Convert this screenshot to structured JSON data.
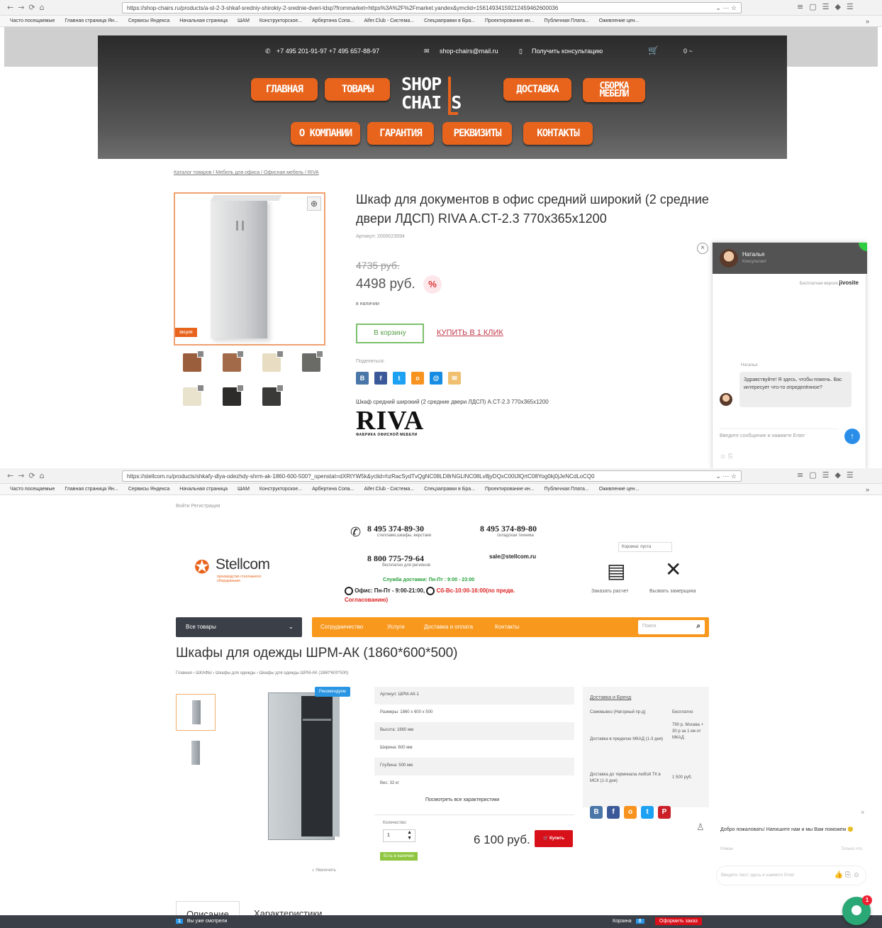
{
  "browser1": {
    "url": "https://shop-chairs.ru/products/a-st-2-3-shkaf-sredniy-shirokiy-2-srednie-dveri-ldsp?frommarket=https%3A%2F%2Fmarket.yandex&ymclid=15614934159212459462600036",
    "bookmarks": [
      "Часто посещаемые",
      "Главная страница Ян...",
      "Сервисы Яндекса",
      "Начальная страница",
      "ШАМ",
      "Конструкторское...",
      "Арбертина Сопа...",
      "Aifer.Club - Система...",
      "Спецзаправки в Бра...",
      "Проектирование ин...",
      "Публичная Плата...",
      "Оживление цен..."
    ]
  },
  "browser2": {
    "url": "https://stellcom.ru/products/shkafy-dlya-odezhdy-shrm-ak-1860-600-500?_openstat=dXRtYW5k&yclid=hzRacSydTvQgNC08LD8rNGLlNC08Lv8jyDQxC00lJlQrtC08Yog0kj0jJeNCdLoCQ0",
    "bookmarks": [
      "Часто посещаемые",
      "Главная страница Ян...",
      "Сервисы Яндекса",
      "Начальная страница",
      "ШАМ",
      "Конструкторское...",
      "Арбертина Сопа...",
      "Aifer.Club - Система...",
      "Спецзаправки в Бра...",
      "Проектирование ин...",
      "Публичная Плата...",
      "Оживление цен..."
    ]
  },
  "shop_chairs": {
    "phones": "+7 495 201-91-97   +7 495 657-88-97",
    "email": "shop-chairs@mail.ru",
    "consult": "Получить консультацию",
    "cart_count": "0 ~",
    "logo_line1": "SHOP",
    "logo_line2": "CHAI S",
    "nav_top": [
      "ГЛАВНАЯ",
      "ТОВАРЫ",
      "ДОСТАВКА",
      "СБОРКА МЕБЕЛИ"
    ],
    "nav_bottom": [
      "О КОМПАНИИ",
      "ГАРАНТИЯ",
      "РЕКВИЗИТЫ",
      "КОНТАКТЫ"
    ],
    "breadcrumb": "Каталог товаров / Мебель для офиса / Офисная мебель / RIVA",
    "promo_badge": "акция",
    "title": "Шкаф для документов в офис средний широкий (2 средние двери ЛДСП) RIVA A.CT-2.3 770x365x1200",
    "sku": "Артикул: 2000023594",
    "old_price": "4735 руб.",
    "price": "4498 руб.",
    "discount_icon": "%",
    "stock": "в наличии",
    "cart_button": "В корзину",
    "one_click": "КУПИТЬ В 1 КЛИК",
    "share_label": "Поделиться:",
    "short_desc": "Шкаф средний широкий (2 средние двери ЛДСП) A.CT-2.3 770x365x1200",
    "brand_word": "RIVA",
    "brand_sub": "ФАБРИКА ОФИСНОЙ МЕБЕЛИ",
    "swatch_colors": [
      "#9a5e3c",
      "#a26a48",
      "#e8dcc2",
      "#6a6a66",
      "#e9e2cc",
      "#2e2c2a",
      "#3a3a38"
    ],
    "social": [
      {
        "label": "В",
        "color": "#4a76a8"
      },
      {
        "label": "f",
        "color": "#3b5998"
      },
      {
        "label": "t",
        "color": "#1da1f2"
      },
      {
        "label": "о",
        "color": "#f7931e"
      },
      {
        "label": "@",
        "color": "#168de2"
      },
      {
        "label": "✉",
        "color": "#f0c070"
      }
    ],
    "chat": {
      "operator": "Наталья",
      "status": "Консультант",
      "powered": "Бесплатная версия",
      "powered_brand": "jivosite",
      "message_author": "Наталья",
      "message": "Здравствуйте! Я здесь, чтобы помочь. Вас интересует что-то определённое?",
      "input_placeholder": "Введите сообщение и нажмите Enter"
    }
  },
  "stellcom": {
    "login_links": "Войти   Регистрация",
    "phone1": "8 495 374-89-30",
    "phone1_sub": "стеллажи,шкафы, верстаки",
    "phone2": "8 495 374-89-80",
    "phone2_sub": "складская техника",
    "phone3": "8 800 775-79-64",
    "phone3_sub": "бесплатно для регионов",
    "email": "sale@stellcom.ru",
    "delivery": "Служба доставки: Пн-Пт : 9:00 - 23:00",
    "office_a": "Офис: Пн-Пт - 9:00-21:00,",
    "office_b": "Сб-Вс-10:00-16:00(по предв. Согласованию)",
    "logo_name": "Stellcom",
    "logo_tag": "производство стеллажного оборудования",
    "cart_empty": "Корзина: пуста",
    "order_calc": "Заказать расчет",
    "call_measurer": "Вызвать замерщика",
    "catalog_button": "Все товары",
    "menu": [
      "Сотрудничество",
      "Услуги",
      "Доставка и оплата",
      "Контакты"
    ],
    "search_placeholder": "Поиск",
    "title": "Шкафы для одежды ШРМ-АК (1860*600*500)",
    "breadcrumb": "Главная  ›  ШКАФЫ  ›  Шкафы для одежды  ›  Шкафы для одежды ШРМ-АК (1860*600*500)",
    "recommend_badge": "Рекомендуем",
    "zoom_label": "Увеличить",
    "specs": [
      "Артикул: ШРМ-АК-1",
      "Размеры: 1860 x 600 x 500",
      "Высота: 1860 мм",
      "Ширина: 600 мм",
      "Глубина: 500 мм",
      "Вес: 32 кг"
    ],
    "all_specs": "Посмотреть все характеристики",
    "qty_label": "Количество:",
    "qty_value": "1",
    "in_stock": "Есть в наличии",
    "price": "6 100 руб.",
    "buy_button": "Купить",
    "delivery_title": "Доставка и Бренд",
    "delivery_rows": [
      {
        "label": "Самовывоз (Нагорный пр-д)",
        "value": "Бесплатно"
      },
      {
        "label": "Доставка в пределах МКАД (1-3 дня)",
        "value": "790 р. Москва + 30 р за 1 км от МКАД"
      },
      {
        "label": "Доставка до терминала любой ТК в МСК (1-3 дня)",
        "value": "1 500 руб."
      }
    ],
    "social": [
      {
        "label": "В",
        "color": "#4a76a8"
      },
      {
        "label": "f",
        "color": "#3b5998"
      },
      {
        "label": "о",
        "color": "#f7931e"
      },
      {
        "label": "t",
        "color": "#1da1f2"
      },
      {
        "label": "P",
        "color": "#cb2027"
      }
    ],
    "chat_message": "Добро пожаловать! Напишите нам и мы Вам поможем 🙂",
    "chat_author": "Роман",
    "chat_time": "Только что",
    "chat_input": "Введите текст здесь и нажмите Enter",
    "tabs": [
      "Описание",
      "Характеристики"
    ],
    "bottom_left": "Вы уже смотрели",
    "bottom_left_count": "1",
    "bottom_cart": "Корзина",
    "bottom_cart_count": "0",
    "bottom_order": "Оформить заказ",
    "fab_count": "1"
  }
}
